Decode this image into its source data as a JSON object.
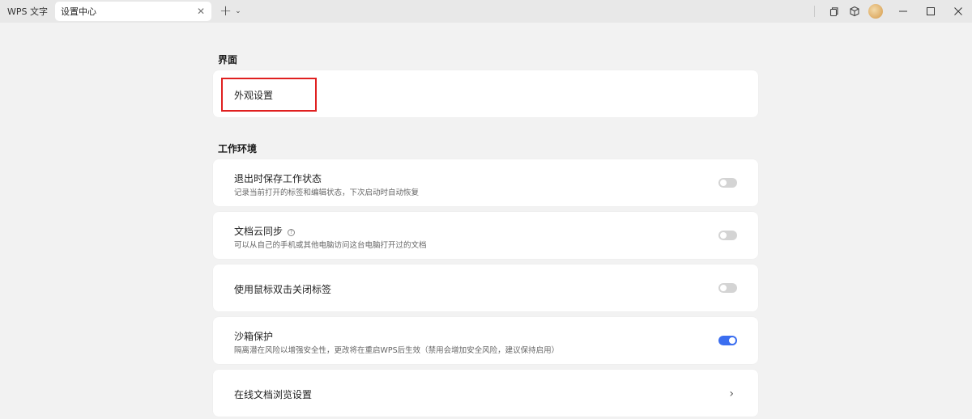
{
  "titlebar": {
    "app_tab": "WPS 文字",
    "active_tab": "设置中心",
    "close_glyph": "✕",
    "new_tab_glyph": "+",
    "dropdown_glyph": "⌄"
  },
  "sections": {
    "interface": {
      "title": "界面",
      "appearance": "外观设置"
    },
    "workspace": {
      "title": "工作环境",
      "items": [
        {
          "label": "退出时保存工作状态",
          "desc": "记录当前打开的标签和编辑状态，下次启动时自动恢复",
          "toggle_on": false
        },
        {
          "label": "文档云同步",
          "help": "?",
          "desc": "可以从自己的手机或其他电脑访问这台电脑打开过的文档",
          "toggle_on": false
        },
        {
          "label": "使用鼠标双击关闭标签",
          "toggle_on": false
        },
        {
          "label": "沙箱保护",
          "desc": "隔离潜在风险以增强安全性，更改将在重启WPS后生效（禁用会增加安全风险，建议保持启用）",
          "toggle_on": true
        },
        {
          "label": "在线文档浏览设置",
          "chevron": "›"
        }
      ]
    }
  },
  "colors": {
    "accent": "#3b6ef0",
    "highlight": "#e02020"
  }
}
